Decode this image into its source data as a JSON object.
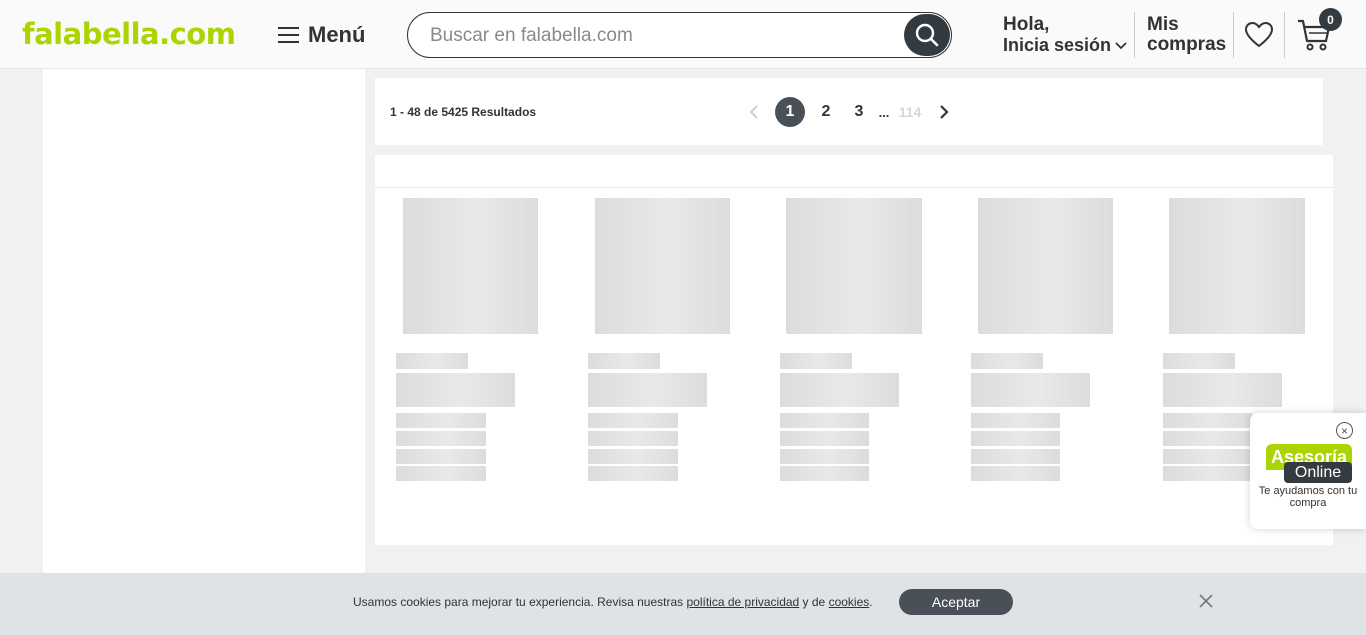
{
  "header": {
    "logo": "falabella.com",
    "menu_label": "Menú",
    "search_placeholder": "Buscar en falabella.com",
    "greeting": "Hola,",
    "login_label": "Inicia sesión",
    "orders_line1": "Mis",
    "orders_line2": "compras",
    "cart_count": "0"
  },
  "results": {
    "count_text": "1 - 48 de 5425 Resultados",
    "pages": [
      "1",
      "2",
      "3",
      "...",
      "114"
    ],
    "active_page": "1"
  },
  "chat": {
    "title": "Asesoría",
    "subtitle": "Online",
    "text": "Te ayudamos con tu compra"
  },
  "cookies": {
    "text_before": "Usamos cookies para mejorar tu experiencia. Revisa nuestras ",
    "privacy_link": "política de privacidad",
    "text_middle": " y de ",
    "cookies_link": "cookies",
    "text_after": ".",
    "accept_label": "Aceptar"
  },
  "colors": {
    "brand_green": "#aad500",
    "dark": "#333a40"
  }
}
